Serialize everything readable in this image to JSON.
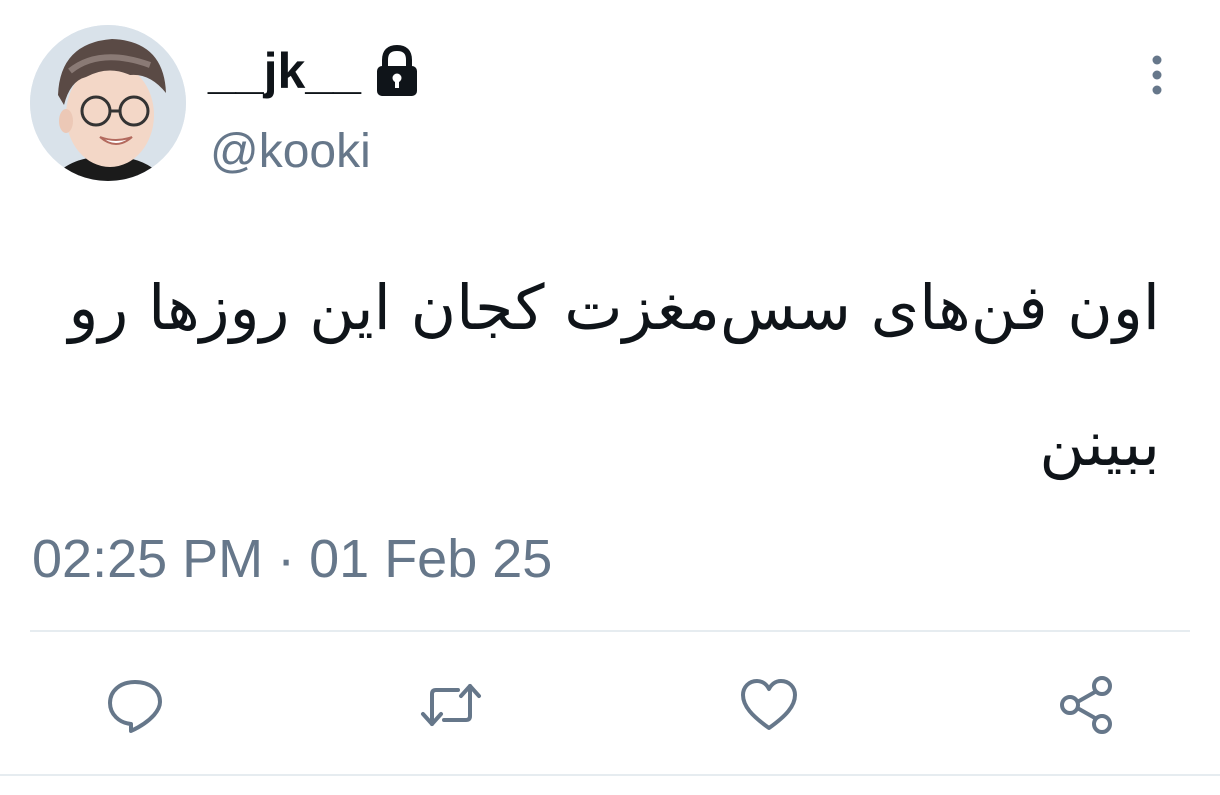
{
  "tweet": {
    "display_name": "__jk__",
    "handle": "@kooki",
    "text": "اون فن‌های سس‌مغزت کجان این روزها رو ببینن",
    "time": "02:25 PM",
    "separator": "·",
    "date": "01 Feb 25",
    "protected_icon": "lock-icon",
    "menu_icon": "more-vertical-icon"
  },
  "actions": [
    {
      "icon": "reply-icon"
    },
    {
      "icon": "retweet-icon"
    },
    {
      "icon": "like-icon"
    },
    {
      "icon": "share-icon"
    }
  ],
  "colors": {
    "text": "#0f1419",
    "secondary": "#66778a",
    "divider": "#e6ecf0"
  }
}
